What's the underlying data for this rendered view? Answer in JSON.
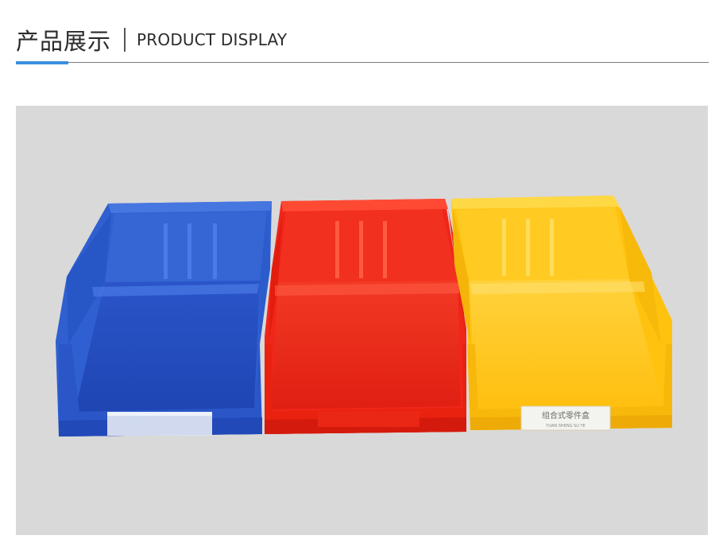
{
  "header": {
    "title_cn": "产品展示",
    "title_en": "PRODUCT DISPLAY"
  },
  "colors": {
    "accent": "#3b8fe0",
    "background_photo": "#d9d9d9",
    "bin_blue": "#2f5fd0",
    "bin_red": "#f0261a",
    "bin_yellow": "#ffc20e"
  },
  "photo": {
    "label_card": {
      "line1": "组合式零件盒",
      "line2": "YUAN SHENG SU YE"
    }
  }
}
